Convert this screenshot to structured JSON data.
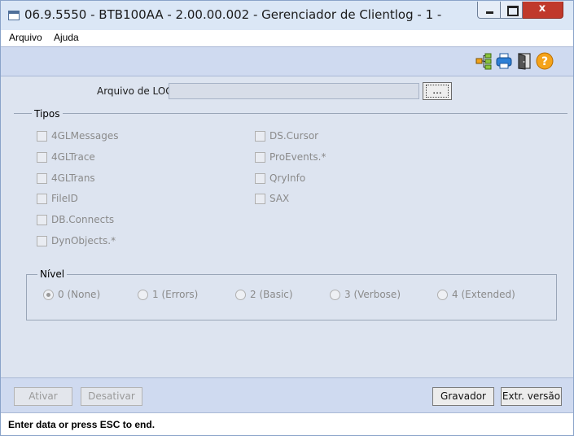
{
  "window": {
    "title": "06.9.5550 - BTB100AA - 2.00.00.002 - Gerenciador de Clientlog - 1 -",
    "close_glyph": "x"
  },
  "menu": [
    "Arquivo",
    "Ajuda"
  ],
  "toolbar": {
    "icons": [
      "hierarchy-icon",
      "printer-icon",
      "exit-door-icon",
      "help-icon"
    ],
    "colors": {
      "help": "#f5a31a",
      "printer": "#2d7fd6",
      "hierarchy": "#f2a21b"
    }
  },
  "log": {
    "label": "Arquivo de LOG:",
    "value": "",
    "browse_label": "..."
  },
  "tipos": {
    "title": "Tipos",
    "left": [
      "4GLMessages",
      "4GLTrace",
      "4GLTrans",
      "FileID",
      "DB.Connects",
      "DynObjects.*"
    ],
    "right": [
      "DS.Cursor",
      "ProEvents.*",
      "QryInfo",
      "SAX"
    ]
  },
  "nivel": {
    "title": "Nível",
    "options": [
      "0 (None)",
      "1 (Errors)",
      "2 (Basic)",
      "3 (Verbose)",
      "4 (Extended)"
    ],
    "selected": 0
  },
  "buttons": {
    "ativar": "Ativar",
    "desativar": "Desativar",
    "gravador": "Gravador",
    "extr_versao": "Extr. versão"
  },
  "status": "Enter data or press ESC to end."
}
